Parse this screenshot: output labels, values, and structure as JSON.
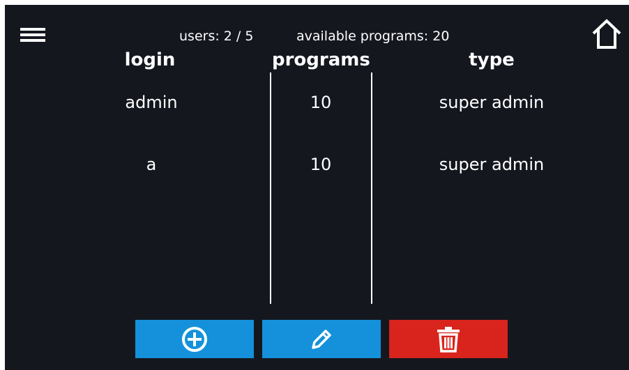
{
  "summary": {
    "users_text": "users: 2 / 5",
    "programs_text": "available programs: 20"
  },
  "table": {
    "headers": [
      "login",
      "programs",
      "type"
    ],
    "rows": [
      {
        "login": "admin",
        "programs": "10",
        "type": "super admin"
      },
      {
        "login": "a",
        "programs": "10",
        "type": "super admin"
      }
    ]
  },
  "icons": {
    "menu": "hamburger-menu-icon",
    "home": "home-icon",
    "add": "plus-circle-icon",
    "edit": "pencil-icon",
    "delete": "trash-icon"
  },
  "colors": {
    "background": "#15171f",
    "add_button": "#1491da",
    "edit_button": "#1491da",
    "delete_button": "#d8241c",
    "text": "#ffffff"
  }
}
